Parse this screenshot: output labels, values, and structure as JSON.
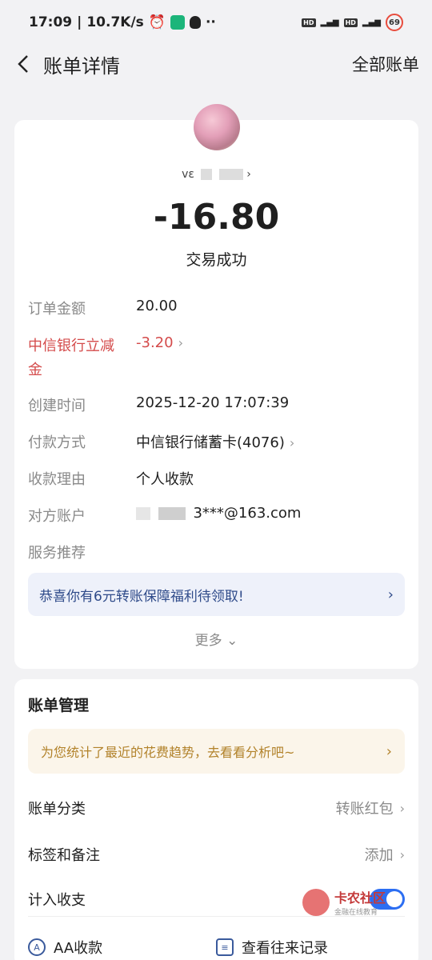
{
  "status_bar": {
    "time": "17:09",
    "speed": "10.7K/s",
    "battery": "69"
  },
  "nav": {
    "title": "账单详情",
    "right": "全部账单"
  },
  "transaction": {
    "payee_prefix": "vε",
    "amount": "-16.80",
    "status": "交易成功"
  },
  "details": [
    {
      "label": "订单金额",
      "value": "20.00"
    },
    {
      "label": "中信银行立减金",
      "value": "-3.20"
    },
    {
      "label": "创建时间",
      "value": "2025-12-20 17:07:39"
    },
    {
      "label": "付款方式",
      "value": "中信银行储蓄卡(4076)"
    },
    {
      "label": "收款理由",
      "value": "个人收款"
    },
    {
      "label": "对方账户",
      "value": "3***@163.com"
    },
    {
      "label": "服务推荐",
      "value": ""
    }
  ],
  "promo": {
    "text": "恭喜你有6元转账保障福利待领取!"
  },
  "more": {
    "label": "更多"
  },
  "management": {
    "title": "账单管理",
    "tip": "为您统计了最近的花费趋势，去看看分析吧~",
    "rows": [
      {
        "label": "账单分类",
        "value": "转账红包"
      },
      {
        "label": "标签和备注",
        "value": "添加"
      },
      {
        "label": "计入收支",
        "value": ""
      }
    ],
    "actions": [
      {
        "label": "AA收款",
        "icon": "aa-icon"
      },
      {
        "label": "查看往来记录",
        "icon": "records-icon"
      }
    ]
  },
  "watermark": {
    "title": "卡农社区",
    "subtitle": "金融在线教育"
  },
  "colors": {
    "accent": "#2c6ef2",
    "discount": "#d44b4b",
    "promo_text": "#2f4b8a",
    "tip_text": "#b2822a"
  }
}
